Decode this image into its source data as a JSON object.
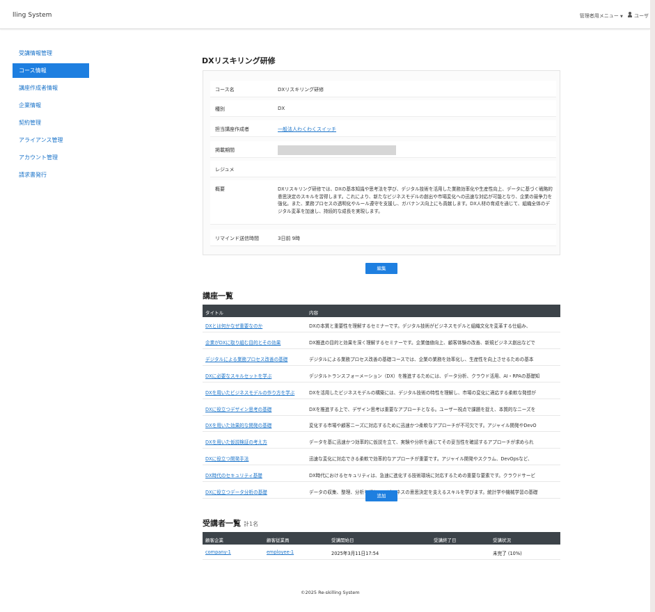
{
  "app": {
    "title": "lling System"
  },
  "topbar": {
    "admin_menu": "管理者用メニュー",
    "user": "ユーザ"
  },
  "sidebar": {
    "items": [
      {
        "label": "受講情報管理"
      },
      {
        "label": "コース情報",
        "active": true
      },
      {
        "label": "講座作成者情報"
      },
      {
        "label": "企業情報"
      },
      {
        "label": "契約管理"
      },
      {
        "label": "アライアンス管理"
      },
      {
        "label": "アカウント管理"
      },
      {
        "label": "請求書発行"
      }
    ]
  },
  "course": {
    "page_title": "DXリスキリング研修",
    "fields": [
      {
        "label": "コース名",
        "value": "DXリスキリング研修"
      },
      {
        "label": "種別",
        "value": "DX"
      },
      {
        "label": "担当講座作成者",
        "value": "一般法人わくわくスイッチ"
      },
      {
        "label": "掲載期間",
        "value": ""
      },
      {
        "label": "レジュメ",
        "value": ""
      },
      {
        "label": "概要",
        "value": "DXリスキリング研修では、DXの基本知識や思考法を学び、デジタル技術を活用した業務効率化や生産性向上、データに基づく戦略的意思決定のスキルを習得します。これにより、新たなビジネスモデルの創出や市場変化への迅速な対応が可能となり、企業の競争力を強化。また、業務プロセスの透明化やルール遵守を支援し、ガバナンス向上にも貢献します。DX人材の育成を通じて、組織全体のデジタル変革を加速し、持続的な成長を実現します。"
      },
      {
        "label": "リマインド送信時間",
        "value": "3日前 9時"
      }
    ],
    "edit_button": "編集"
  },
  "lectures": {
    "heading": "講座一覧",
    "columns": [
      "タイトル",
      "内容"
    ],
    "rows": [
      {
        "title": "DXとは何かなぜ重要なのか",
        "content": "DXの本質と重要性を理解するセミナーです。デジタル技術がビジネスモデルと組織文化を変革する仕組み、"
      },
      {
        "title": "企業がDXに取り組む目的とその効果",
        "content": "DX推進の目的と効果を深く理解するセミナーです。企業価値向上、顧客体験の改善、新規ビジネス創出などで"
      },
      {
        "title": "デジタルによる業務プロセス改善の基礎",
        "content": "デジタルによる業務プロセス改善の基礎コースでは、企業の業務を効率化し、生産性を向上させるための基本"
      },
      {
        "title": "DXに必要なスキルセットを学ぶ",
        "content": "デジタルトランスフォーメーション（DX）を推進するためには、データ分析、クラウド活用、AI・RPAの基礎知"
      },
      {
        "title": "DXを用いたビジネスモデルの作り方を学ぶ",
        "content": "DXを活用したビジネスモデルの構築には、デジタル技術の特性を理解し、市場の変化に適応する柔軟な発想が"
      },
      {
        "title": "DXに役立つデザイン思考の基礎",
        "content": "DXを推進する上で、デザイン思考は重要なアプローチとなる。ユーザー視点で課題を捉え、本質的なニーズを"
      },
      {
        "title": "DXを用いた効果的な開発の基礎",
        "content": "変化する市場や顧客ニーズに対応するために迅速かつ柔軟なアプローチが不可欠です。アジャイル開発やDevO"
      },
      {
        "title": "DXを用いた仮説検証の考え方",
        "content": "データを基に迅速かつ効率的に仮説を立て、実験や分析を通じてその妥当性を確認するアプローチが求められ"
      },
      {
        "title": "DXに役立つ開発手法",
        "content": "迅速な変化に対応できる柔軟で効率的なアプローチが重要です。アジャイル開発やスクラム、DevOpsなど、"
      },
      {
        "title": "DX時代のセキュリティ基礎",
        "content": "DX時代におけるセキュリティは、急速に進化する技術環境に対応するための重要な要素です。クラウドサービ"
      },
      {
        "title": "DXに役立つデータ分析の基礎",
        "content": "データの収集、整理、分析を通じて、ビジネスの意思決定を支えるスキルを学びます。統計学や機械学習の基礎"
      }
    ],
    "add_button": "追加"
  },
  "students": {
    "heading": "受講者一覧",
    "count": "計1名",
    "columns": [
      "顧客企業",
      "顧客従業員",
      "受講開始日",
      "受講終了日",
      "受講状況"
    ],
    "rows": [
      {
        "company": "company-1",
        "employee": "employee-1",
        "start": "2025年3月11日17:54",
        "end": "",
        "status": "未完了 (10%)"
      }
    ]
  },
  "footer": {
    "text": "©2025 Re-skilling System"
  }
}
